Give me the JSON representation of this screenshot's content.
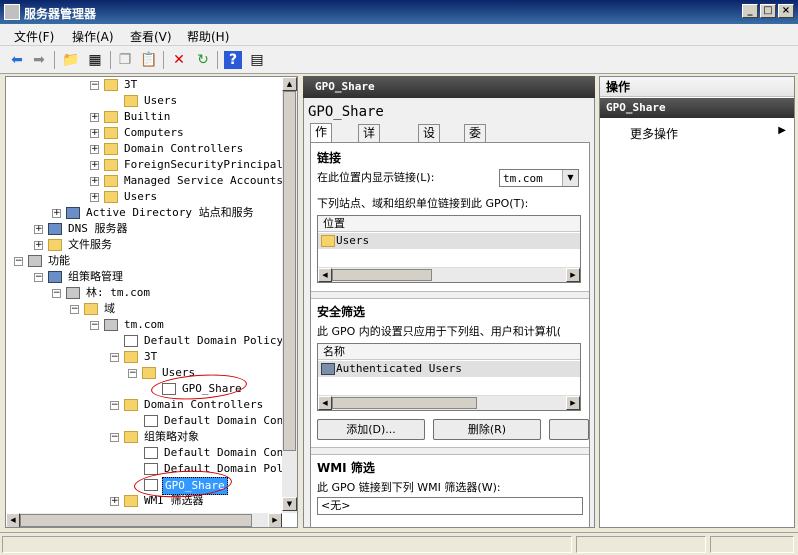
{
  "window": {
    "title": "服务器管理器"
  },
  "menu": [
    "文件(F)",
    "操作(A)",
    "查看(V)",
    "帮助(H)"
  ],
  "tree": {
    "nodes": [
      {
        "label": "3T"
      },
      {
        "label": "Users"
      },
      {
        "label": "Builtin"
      },
      {
        "label": "Computers"
      },
      {
        "label": "Domain Controllers"
      },
      {
        "label": "ForeignSecurityPrincipals"
      },
      {
        "label": "Managed Service Accounts"
      },
      {
        "label": "Users"
      },
      {
        "label": "Active Directory 站点和服务"
      },
      {
        "label": "DNS 服务器"
      },
      {
        "label": "文件服务"
      },
      {
        "label": "功能"
      },
      {
        "label": "组策略管理"
      },
      {
        "label": "林: tm.com"
      },
      {
        "label": "域"
      },
      {
        "label": "tm.com"
      },
      {
        "label": "Default Domain Policy"
      },
      {
        "label": "3T"
      },
      {
        "label": "Users"
      },
      {
        "label": "GPO_Share"
      },
      {
        "label": "Domain Controllers"
      },
      {
        "label": "Default Domain Contr"
      },
      {
        "label": "组策略对象"
      },
      {
        "label": "Default Domain Contr"
      },
      {
        "label": "Default Domain Polic"
      },
      {
        "label": "GPO_Share"
      },
      {
        "label": "WMI 筛选器"
      }
    ]
  },
  "details": {
    "header": "GPO_Share",
    "title": "GPO_Share",
    "tabs": [
      "作用域",
      "详细信息",
      "设置",
      "委派"
    ],
    "links": {
      "heading": "链接",
      "location_label": "在此位置内显示链接(L):",
      "location_value": "tm.com",
      "linked_label": "下列站点、域和组织单位链接到此 GPO(T):",
      "column": "位置",
      "rows": [
        "Users"
      ]
    },
    "security": {
      "heading": "安全筛选",
      "description": "此 GPO 内的设置只应用于下列组、用户和计算机(",
      "column": "名称",
      "rows": [
        "Authenticated Users"
      ],
      "add_button": "添加(D)...",
      "remove_button": "删除(R)"
    },
    "wmi": {
      "heading": "WMI 筛选",
      "label": "此 GPO 链接到下列 WMI 筛选器(W):",
      "value": "<无>"
    }
  },
  "actions": {
    "heading": "操作",
    "subheading": "GPO_Share",
    "items": [
      "更多操作"
    ]
  }
}
